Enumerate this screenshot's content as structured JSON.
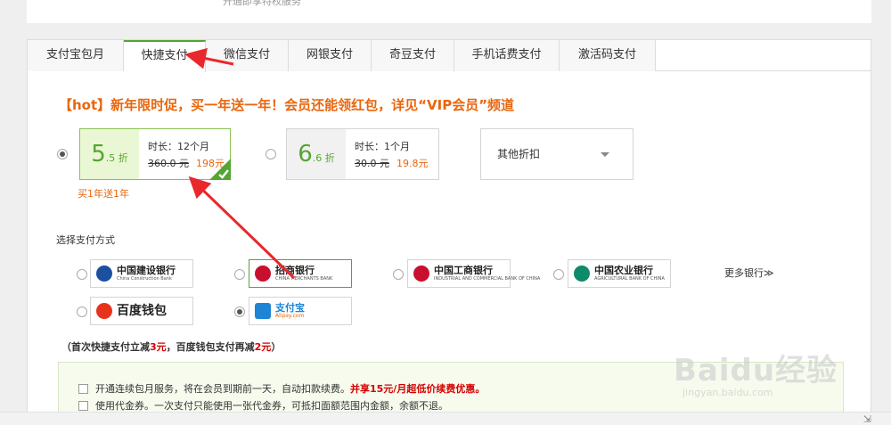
{
  "top_text": "开通即享特权服务",
  "tabs": [
    {
      "label": "支付宝包月"
    },
    {
      "label": "快捷支付",
      "active": true
    },
    {
      "label": "微信支付"
    },
    {
      "label": "网银支付"
    },
    {
      "label": "奇豆支付"
    },
    {
      "label": "手机话费支付"
    },
    {
      "label": "激活码支付"
    }
  ],
  "promo": "【hot】新年限时促，买一年送一年！会员还能领红包，详见“VIP会员”频道",
  "plans": [
    {
      "discount_num": "5",
      "discount_sub": ".5 折",
      "duration": "时长：12个月",
      "original": "360.0 元",
      "price": "198元",
      "selected": true
    },
    {
      "discount_num": "6",
      "discount_sub": ".6 折",
      "duration": "时长：1个月",
      "original": "30.0 元",
      "price": "19.8元",
      "selected": false
    }
  ],
  "other_discount": "其他折扣",
  "bonus": "买1年送1年",
  "pay_method_title": "选择支付方式",
  "banks": [
    {
      "name": "中国建设银行",
      "en": "China Construction Bank",
      "color": "#1b4fa0"
    },
    {
      "name": "招商银行",
      "en": "CHINA MERCHANTS BANK",
      "color": "#c8102e"
    },
    {
      "name": "中国工商银行",
      "en": "INDUSTRIAL AND COMMERCIAL BANK OF CHINA",
      "color": "#c8102e"
    },
    {
      "name": "中国农业银行",
      "en": "AGRICULTURAL BANK OF CHINA",
      "color": "#0f8a6a"
    },
    {
      "name": "百度钱包",
      "en": "",
      "color": "#e8331b"
    },
    {
      "name": "支付宝",
      "en": "Alipay.com",
      "color": "#1d84d6"
    }
  ],
  "more_banks": "更多银行≫",
  "note": {
    "prefix": "（首次快捷支付立减",
    "amount1": "3元",
    "middle": "，百度钱包支付再减",
    "amount2": "2元",
    "suffix": "）"
  },
  "options": [
    {
      "text": "开通连续包月服务，将在会员到期前一天，自动扣款续费。",
      "highlight": "并享15元/月超低价续费优惠。"
    },
    {
      "text": "使用代金券。一次支付只能使用一张代金券，可抵扣面额范围内金额，余额不退。",
      "highlight": ""
    }
  ],
  "watermark": {
    "brand": "Baidu经验",
    "url": "jingyan.baidu.com"
  },
  "colors": {
    "accent": "#55a532",
    "promo": "#e8660d",
    "arrow": "#e8282c"
  }
}
